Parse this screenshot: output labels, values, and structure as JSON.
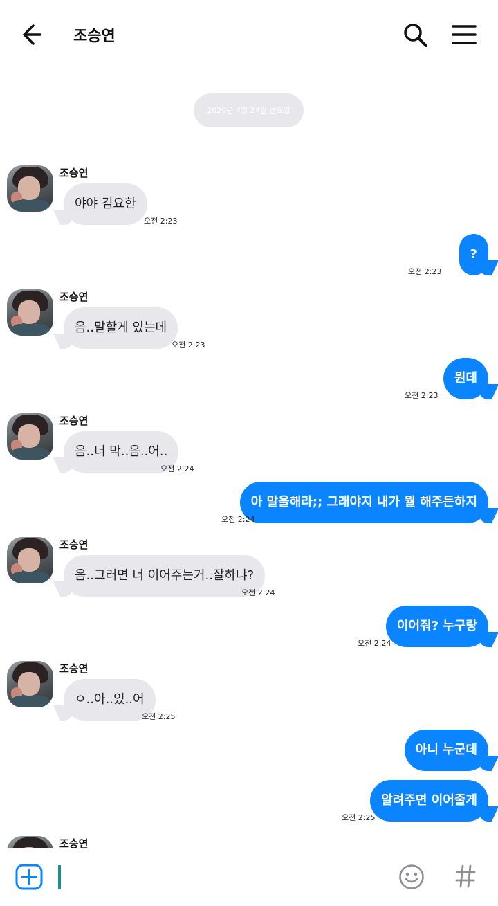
{
  "header": {
    "title": "조승연"
  },
  "date_divider": "2020년 4월 24일 금요일",
  "contact": {
    "name": "조승연"
  },
  "messages": [
    {
      "dir": "in",
      "name": "조승연",
      "text": "야야 김요한",
      "time": "오전 2:23"
    },
    {
      "dir": "out",
      "text": "?",
      "time": "오전 2:23"
    },
    {
      "dir": "in",
      "name": "조승연",
      "text": "음..말할게 있는데",
      "time": "오전 2:23"
    },
    {
      "dir": "out",
      "text": "뭔데",
      "time": "오전 2:23"
    },
    {
      "dir": "in",
      "name": "조승연",
      "text": "음..너 막..음..어..",
      "time": "오전 2:24"
    },
    {
      "dir": "out",
      "text": "아 말을해라;; 그래야지 내가 뭘 해주든하지",
      "time": "오전 2:24"
    },
    {
      "dir": "in",
      "name": "조승연",
      "text": "음..그러면 너 이어주는거..잘하냐?",
      "time": "오전 2:24"
    },
    {
      "dir": "out",
      "text": "이어줘? 누구랑",
      "time": "오전 2:24"
    },
    {
      "dir": "in",
      "name": "조승연",
      "text": "ㅇ..아..있..어",
      "time": "오전 2:25"
    },
    {
      "dir": "out",
      "text": "아니 누군데",
      "time": ""
    },
    {
      "dir": "out",
      "text": "알려주면 이어줄게",
      "time": "오전 2:25"
    },
    {
      "dir": "in",
      "name": "조승연",
      "text": "",
      "time": ""
    }
  ],
  "composer": {
    "value": ""
  },
  "icons": {
    "back": "arrow-left-icon",
    "search": "search-icon",
    "menu": "menu-icon",
    "attach": "plus-icon",
    "emoji": "smiley-icon",
    "hashtag": "hash-icon"
  },
  "colors": {
    "outgoing": "#0a84ff",
    "incoming": "#e7e7ec",
    "caret": "#1b8f8a"
  }
}
